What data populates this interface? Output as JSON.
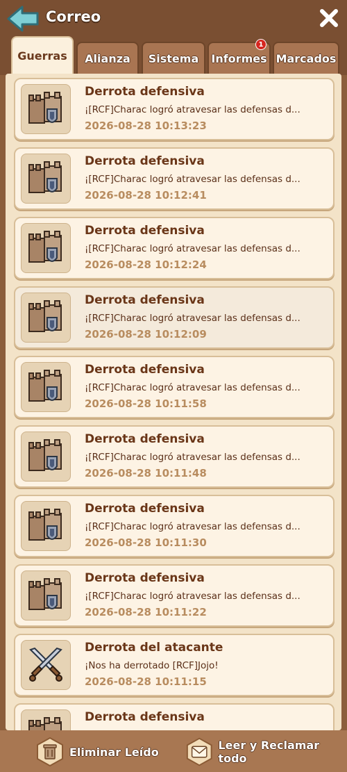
{
  "header": {
    "title": "Correo"
  },
  "tabs": [
    {
      "label": "Guerras",
      "active": true
    },
    {
      "label": "Alianza"
    },
    {
      "label": "Sistema"
    },
    {
      "label": "Informes",
      "badge": "1"
    },
    {
      "label": "Marcados"
    }
  ],
  "mails": [
    {
      "title": "Derrota defensiva",
      "text": "¡[RCF]Charac logró atravesar las defensas d...",
      "date": "2026-08-28 10:13:23",
      "icon": "castle-shield-icon"
    },
    {
      "title": "Derrota defensiva",
      "text": "¡[RCF]Charac logró atravesar las defensas d...",
      "date": "2026-08-28 10:12:41",
      "icon": "castle-shield-icon"
    },
    {
      "title": "Derrota defensiva",
      "text": "¡[RCF]Charac logró atravesar las defensas d...",
      "date": "2026-08-28 10:12:24",
      "icon": "castle-shield-icon"
    },
    {
      "title": "Derrota defensiva",
      "text": "¡[RCF]Charac logró atravesar las defensas d...",
      "date": "2026-08-28 10:12:09",
      "icon": "castle-shield-icon"
    },
    {
      "title": "Derrota defensiva",
      "text": "¡[RCF]Charac logró atravesar las defensas d...",
      "date": "2026-08-28 10:11:58",
      "icon": "castle-shield-icon"
    },
    {
      "title": "Derrota defensiva",
      "text": "¡[RCF]Charac logró atravesar las defensas d...",
      "date": "2026-08-28 10:11:48",
      "icon": "castle-shield-icon"
    },
    {
      "title": "Derrota defensiva",
      "text": "¡[RCF]Charac logró atravesar las defensas d...",
      "date": "2026-08-28 10:11:30",
      "icon": "castle-shield-icon"
    },
    {
      "title": "Derrota defensiva",
      "text": "¡[RCF]Charac logró atravesar las defensas d...",
      "date": "2026-08-28 10:11:22",
      "icon": "castle-shield-icon"
    },
    {
      "title": "Derrota del atacante",
      "text": "¡Nos ha derrotado [RCF]Jojo!",
      "date": "2026-08-28 10:11:15",
      "icon": "crossed-swords-icon"
    },
    {
      "title": "Derrota defensiva",
      "text": "",
      "date": "",
      "icon": "castle-shield-icon"
    }
  ],
  "footer": {
    "delete_label": "Eliminar Leído",
    "claim_label": "Leer y Reclamar todo"
  }
}
